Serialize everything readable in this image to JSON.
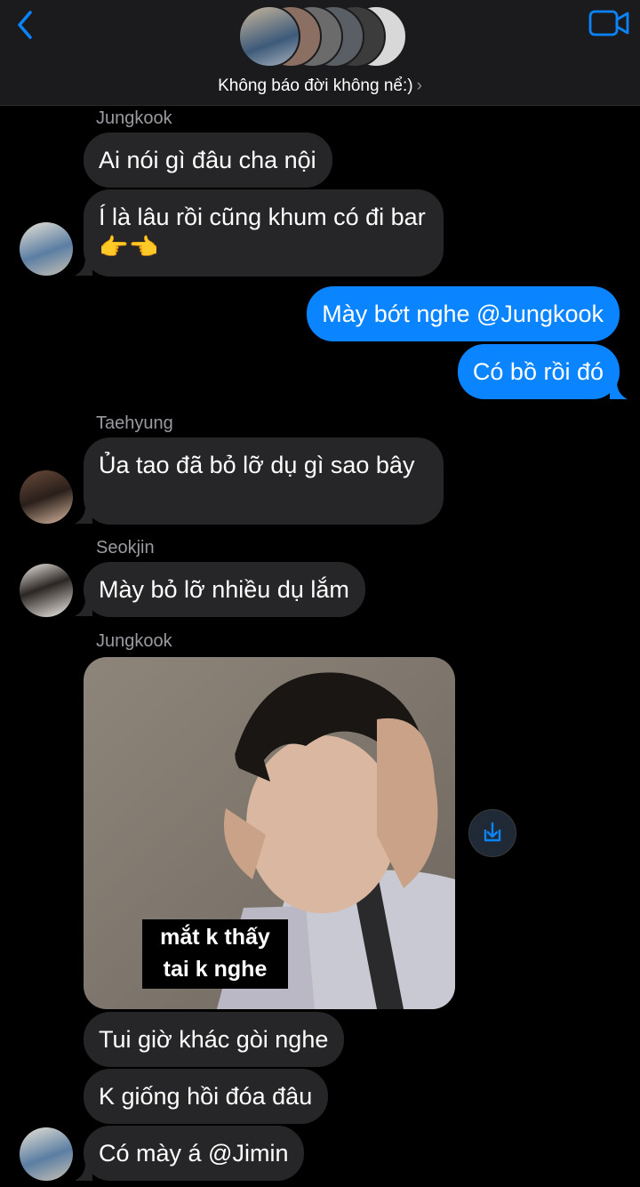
{
  "header": {
    "group_name": "Không báo đời không nể:)",
    "chevron": "›",
    "back_icon": "chevron-left-icon",
    "video_icon": "video-camera-icon",
    "accent": "#0a84ff"
  },
  "messages": [
    {
      "sender": "Jungkook",
      "text": "Ai nói gì đâu cha nội"
    },
    {
      "text": "Í là lâu rồi cũng khum có đi bar👉👈"
    },
    {
      "outgoing": true,
      "text": "Mày bớt nghe @Jungkook"
    },
    {
      "outgoing": true,
      "text": "Có bồ rồi đó"
    },
    {
      "sender": "Taehyung",
      "text": "Ủa tao đã bỏ lỡ dụ gì sao bây"
    },
    {
      "sender": "Seokjin",
      "text": "Mày bỏ lỡ nhiều dụ lắm"
    },
    {
      "sender": "Jungkook",
      "image_caption": "mắt k thấy\ntai k nghe"
    },
    {
      "text": "Tui giờ khác gòi nghe"
    },
    {
      "text": "K giống hồi đóa đâu"
    },
    {
      "text": "Có mày á @Jimin"
    }
  ],
  "colors": {
    "incoming_bubble": "#262628",
    "outgoing_bubble": "#0a84ff",
    "background": "#000000"
  }
}
